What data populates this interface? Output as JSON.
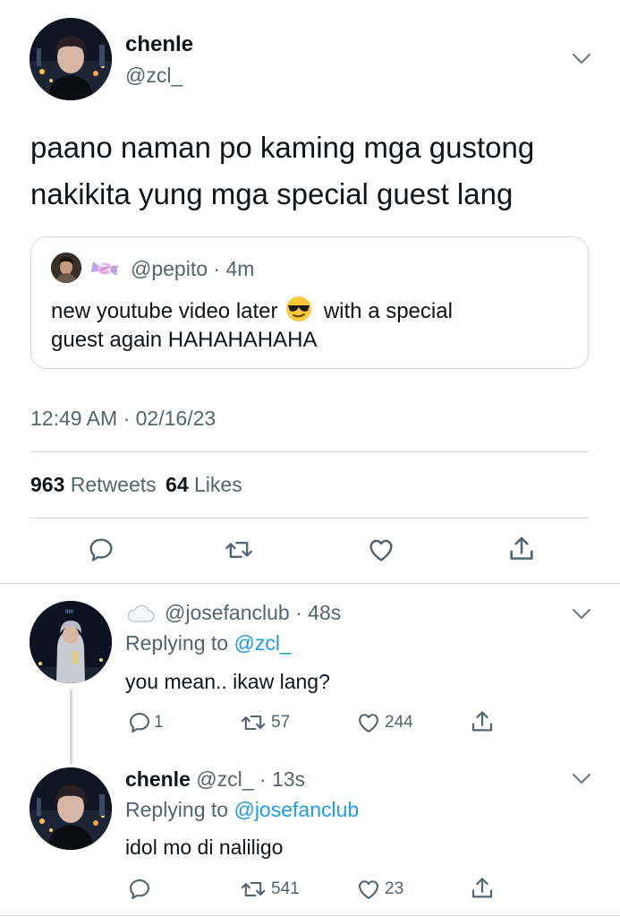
{
  "main_tweet": {
    "display_name": "chenle",
    "handle": "@zcl_",
    "text_line1": "paano naman po kaming mga gustong",
    "text_line2": "nakikita yung mga special guest lang",
    "quoted": {
      "handle": "@pepito",
      "time": "4m",
      "text_part1": "new youtube video later",
      "text_part2": "with a special",
      "text_line2": "guest again HAHAHAHAHA"
    },
    "timestamp": "12:49 AM",
    "date": "02/16/23",
    "retweet_count": "963",
    "retweets_label": "Retweets",
    "like_count": "64",
    "likes_label": "Likes"
  },
  "replies": [
    {
      "handle": "@josefanclub",
      "time": "48s",
      "replying_label": "Replying to",
      "replying_to": "@zcl_",
      "text": "you mean.. ikaw lang?",
      "reply_count": "1",
      "retweet_count": "57",
      "like_count": "244"
    },
    {
      "display_name": "chenle",
      "handle": "@zcl_",
      "time": "13s",
      "replying_label": "Replying to",
      "replying_to": "@josefanclub",
      "text": "idol mo di naliligo",
      "reply_count": "",
      "retweet_count": "541",
      "like_count": "23"
    }
  ],
  "icons": [
    "chevron-down-icon",
    "reply-icon",
    "retweet-icon",
    "like-icon",
    "share-icon",
    "candy-icon",
    "cloud-icon",
    "sunglasses-emoji-icon"
  ],
  "colors": {
    "link": "#1d9bf0",
    "muted": "#536471",
    "divider": "#cfd9de",
    "text": "#0f1419"
  }
}
